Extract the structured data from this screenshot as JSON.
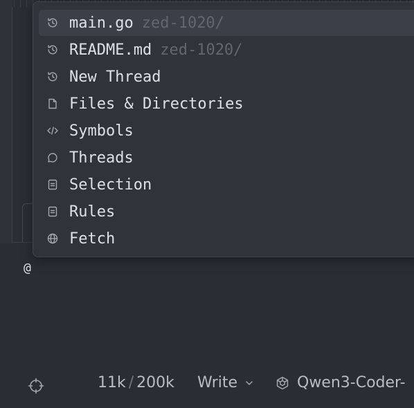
{
  "mention_menu": {
    "items": [
      {
        "label": "main.go",
        "hint": "zed-1020/",
        "icon": "history-icon",
        "selected": true
      },
      {
        "label": "README.md",
        "hint": "zed-1020/",
        "icon": "history-icon",
        "selected": false
      },
      {
        "label": "New Thread",
        "hint": "",
        "icon": "history-icon",
        "selected": false
      },
      {
        "label": "Files & Directories",
        "hint": "",
        "icon": "file-icon",
        "selected": false
      },
      {
        "label": "Symbols",
        "hint": "",
        "icon": "code-icon",
        "selected": false
      },
      {
        "label": "Threads",
        "hint": "",
        "icon": "chat-bubble-icon",
        "selected": false
      },
      {
        "label": "Selection",
        "hint": "",
        "icon": "text-snippet-icon",
        "selected": false
      },
      {
        "label": "Rules",
        "hint": "",
        "icon": "text-snippet-icon",
        "selected": false
      },
      {
        "label": "Fetch",
        "hint": "",
        "icon": "globe-icon",
        "selected": false
      }
    ]
  },
  "editor": {
    "input_text": "@"
  },
  "footer": {
    "tokens_used": "11k",
    "tokens_separator": "/",
    "tokens_limit": "200k",
    "mode_label": "Write",
    "model_label": "Qwen3-Coder-"
  },
  "colors": {
    "background": "#2a2d33",
    "popup_bg": "#30333a",
    "selected_bg": "#3c3f47",
    "text": "#dde1e6",
    "muted_text": "#62666e"
  }
}
